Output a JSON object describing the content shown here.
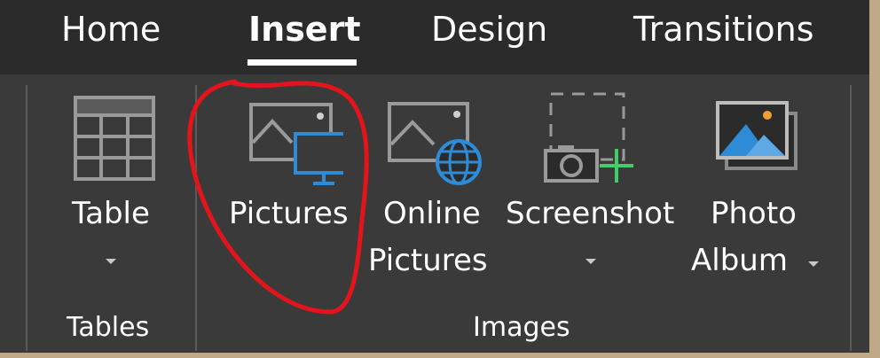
{
  "tabs": {
    "home": "Home",
    "insert": "Insert",
    "design": "Design",
    "transitions": "Transitions"
  },
  "ribbon": {
    "tables_group_label": "Tables",
    "images_group_label": "Images",
    "table_label": "Table",
    "pictures_label": "Pictures",
    "online_pictures_line1": "Online",
    "online_pictures_line2": "Pictures",
    "screenshot_label": "Screenshot",
    "photo_album_line1": "Photo",
    "photo_album_line2": "Album"
  },
  "icons": {
    "table": "table-grid-icon",
    "pictures": "pictures-monitor-icon",
    "online_pictures": "picture-globe-icon",
    "screenshot": "camera-plus-icon",
    "photo_album": "photo-album-icon"
  },
  "colors": {
    "ribbon_bg": "#3a3a3a",
    "tab_bg": "#2b2b2b",
    "text": "#ffffff",
    "accent_blue": "#2e8bd8",
    "accent_green": "#3ecf6a",
    "annotation_red": "#e3141b"
  }
}
